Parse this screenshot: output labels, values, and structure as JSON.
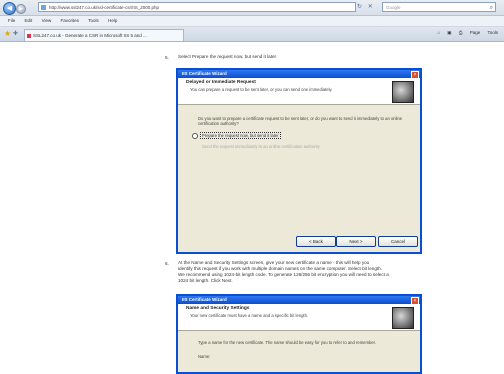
{
  "browser": {
    "url": "http://www.ssl247.co.uk/ssl-certificate-csr/IIS_2000.php",
    "search_placeholder": "Google",
    "menu": [
      "File",
      "Edit",
      "View",
      "Favorites",
      "Tools",
      "Help"
    ],
    "tab_title": "SSL247.co.uk - Generate a CSR in Microsoft IIS 5 and ...",
    "toolbar_tools": [
      "Page",
      "Tools"
    ],
    "back_glyph": "◀",
    "forward_glyph": "▶"
  },
  "steps": {
    "step5_num": "5.",
    "step5_text": "Select Prepare the request now, but send it later.",
    "step6_num": "6.",
    "step6_line1": "At the Name and Security Settings screen, give your new certificate a name - this will help you",
    "step6_line2": "identify this request if you work with multiple domain names on the same computer. Select bit length.",
    "step6_line3": "We recommend using 1024-bit length code. To generate 128/256 bit encryption you will need to select a",
    "step6_line4": "1024 bit length. Click Next."
  },
  "dialog1": {
    "title": "IIS Certificate Wizard",
    "close_glyph": "×",
    "header": "Delayed or Immediate Request",
    "desc": "You can prepare a request to be sent later, or you can send one immediately.",
    "question": "Do you want to prepare a certificate request to be sent later, or do you want to send it immediately to an online certification authority?",
    "option1": "Prepare the request now, but send it later",
    "option2": "Send the request immediately to an online certification authority",
    "back": "< Back",
    "next": "Next >",
    "cancel": "Cancel"
  },
  "dialog2": {
    "title": "IIS Certificate Wizard",
    "close_glyph": "×",
    "header": "Name and Security Settings",
    "desc": "Your new certificate must have a name and a specific bit length.",
    "body": "Type a name for the new certificate. The name should be easy for you to refer to and remember.",
    "field_label": "Name:"
  }
}
